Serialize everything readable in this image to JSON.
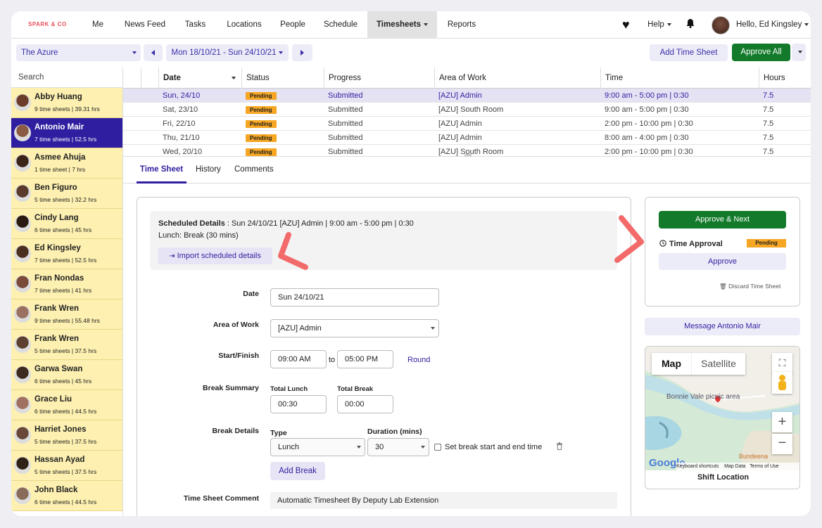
{
  "nav": {
    "logo": "SPARK & CO",
    "items": [
      "Me",
      "News Feed",
      "Tasks",
      "Locations",
      "People",
      "Schedule"
    ],
    "active": "Timesheets",
    "reports": "Reports",
    "help": "Help",
    "greeting": "Hello, Ed Kingsley"
  },
  "toolbar": {
    "location": "The Azure",
    "date_range": "Mon 18/10/21 - Sun 24/10/21",
    "add_time_sheet": "Add Time Sheet",
    "approve_all": "Approve All"
  },
  "sidebar": {
    "search_placeholder": "Search",
    "people": [
      {
        "name": "Abby Huang",
        "sub": "9 time sheets | 39.31 hrs"
      },
      {
        "name": "Antonio Mair",
        "sub": "7 time sheets | 52.5 hrs"
      },
      {
        "name": "Asmee Ahuja",
        "sub": "1 time sheet | 7 hrs"
      },
      {
        "name": "Ben Figuro",
        "sub": "5 time sheets | 32.2 hrs"
      },
      {
        "name": "Cindy Lang",
        "sub": "6 time sheets | 45 hrs"
      },
      {
        "name": "Ed Kingsley",
        "sub": "7 time sheets | 52.5 hrs"
      },
      {
        "name": "Fran Nondas",
        "sub": "7 time sheets | 41 hrs"
      },
      {
        "name": "Frank Wren",
        "sub": "9 time sheets | 55.48 hrs"
      },
      {
        "name": "Frank Wren",
        "sub": "5 time sheets | 37.5 hrs"
      },
      {
        "name": "Garwa Swan",
        "sub": "6 time sheets | 45 hrs"
      },
      {
        "name": "Grace Liu",
        "sub": "6 time sheets | 44.5 hrs"
      },
      {
        "name": "Harriet Jones",
        "sub": "5 time sheets | 37.5 hrs"
      },
      {
        "name": "Hassan Ayad",
        "sub": "5 time sheets | 37.5 hrs"
      },
      {
        "name": "John Black",
        "sub": "6 time sheets | 44.5 hrs"
      }
    ]
  },
  "table": {
    "headers": [
      "Date",
      "Status",
      "Progress",
      "Area of Work",
      "Time",
      "Hours"
    ],
    "rows": [
      {
        "date": "Sun, 24/10",
        "status": "Pending",
        "progress": "Submitted",
        "area": "[AZU] Admin",
        "time": "9:00 am - 5:00 pm | 0:30",
        "hours": "7.5"
      },
      {
        "date": "Sat, 23/10",
        "status": "Pending",
        "progress": "Submitted",
        "area": "[AZU] South Room",
        "time": "9:00 am - 5:00 pm | 0:30",
        "hours": "7.5"
      },
      {
        "date": "Fri, 22/10",
        "status": "Pending",
        "progress": "Submitted",
        "area": "[AZU] Admin",
        "time": "2:00 pm - 10:00 pm | 0:30",
        "hours": "7.5"
      },
      {
        "date": "Thu, 21/10",
        "status": "Pending",
        "progress": "Submitted",
        "area": "[AZU] Admin",
        "time": "8:00 am - 4:00 pm | 0:30",
        "hours": "7.5"
      },
      {
        "date": "Wed, 20/10",
        "status": "Pending",
        "progress": "Submitted",
        "area": "[AZU] South Room",
        "time": "2:00 pm - 10:00 pm | 0:30",
        "hours": "7.5"
      }
    ]
  },
  "tabs": [
    "Time Sheet",
    "History",
    "Comments"
  ],
  "form": {
    "scheduled_label": "Scheduled Details",
    "scheduled_value": ": Sun 24/10/21 [AZU] Admin | 9:00 am - 5:00 pm | 0:30",
    "lunch": "Lunch: Break (30 mins)",
    "import_btn": "Import scheduled details",
    "date_label": "Date",
    "date_value": "Sun 24/10/21",
    "area_label": "Area of Work",
    "area_value": "[AZU] Admin",
    "start_finish_label": "Start/Finish",
    "start": "09:00 AM",
    "to": "to",
    "finish": "05:00 PM",
    "round": "Round",
    "break_summary_label": "Break Summary",
    "total_lunch_label": "Total Lunch",
    "total_lunch": "00:30",
    "total_break_label": "Total Break",
    "total_break": "00:00",
    "break_details_label": "Break Details",
    "type_label": "Type",
    "type_value": "Lunch",
    "duration_label": "Duration (mins)",
    "duration_value": "30",
    "set_break_label": "Set break start and end time",
    "add_break": "Add Break",
    "comment_label": "Time Sheet Comment",
    "comment_value": "Automatic Timesheet By Deputy Lab Extension"
  },
  "approval": {
    "approve_next": "Approve & Next",
    "time_approval": "Time Approval",
    "status": "Pending",
    "approve": "Approve",
    "discard": "Discard Time Sheet",
    "message": "Message Antonio Mair"
  },
  "map": {
    "tab_map": "Map",
    "tab_satellite": "Satellite",
    "place": "Bonnie Vale picnic area",
    "place2": "Bundeena",
    "google": "Google",
    "keyboard": "Keyboard shortcuts",
    "map_data": "Map Data",
    "terms": "Terms of Use",
    "caption": "Shift Location"
  },
  "colors": {
    "accent": "#2f1fa0",
    "approve_green": "#127a2a",
    "pending": "#f6a623",
    "selected_bg": "#fdf0b0",
    "annotation_arrow": "#f26a6a"
  }
}
